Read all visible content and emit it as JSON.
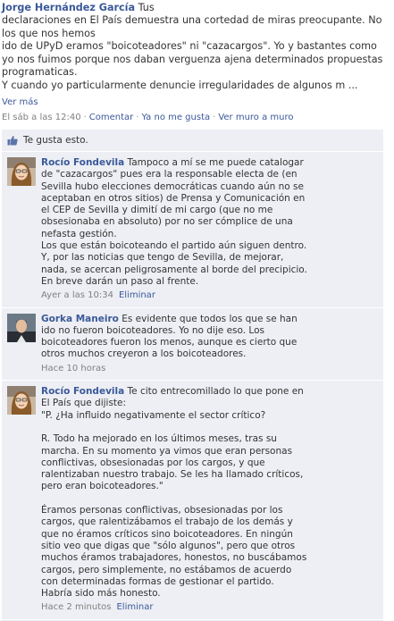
{
  "post": {
    "author": "Jorge Hernández García",
    "first_line": "Tus",
    "text": "declaraciones en El País demuestra una cortedad de miras preocupante. No\nlos que nos hemos\nido de UPyD eramos \"boicoteadores\" ni \"cazacargos\". Yo y bastantes como\nyo nos fuimos porque nos daban verguenza ajena determinados propuestas\nprogramaticas.\nY cuando yo particularmente denuncie irregularidades de algunos m ...",
    "see_more": "Ver más",
    "timestamp": "El sáb a las 12:40",
    "comment_link": "Comentar",
    "unlike_link": "Ya no me gusta",
    "wall_link": "Ver muro a muro"
  },
  "likes": {
    "text": "Te gusta esto."
  },
  "comments": [
    {
      "author": "Rocío Fondevila",
      "text": " Tampoco a mí se me puede catalogar de \"cazacargos\" pues era la responsable electa de (en Sevilla hubo elecciones democráticas cuando aún no se aceptaban en otros sitios) de Prensa y Comunicación en el CEP de Sevilla y dimití de mi cargo (que no me obsesionaba en absoluto) por no ser cómplice de una nefasta gestión.\nLos que están boicoteando el partido aún siguen dentro. Y, por las noticias que tengo de Sevilla, de mejorar, nada, se acercan peligrosamente al borde del precipicio. En breve darán un paso al frente.",
      "time": "Ayer a las 10:34",
      "delete": "Eliminar"
    },
    {
      "author": "Gorka Maneiro",
      "text": " Es evidente que todos los que se han ido no fueron boicoteadores. Yo no dije eso. Los boicoteadores fueron los menos, aunque es cierto que otros muchos creyeron a los boicoteadores.",
      "time": "Hace 10 horas",
      "delete": ""
    },
    {
      "author": "Rocío Fondevila",
      "text": " Te cito entrecomillado lo que pone en El País que dijiste:\n\"P. ¿Ha influido negativamente el sector crítico?\n\nR. Todo ha mejorado en los últimos meses, tras su marcha. En su momento ya vimos que eran personas conflictivas, obsesionadas por los cargos, y que ralentizaban nuestro trabajo. Se les ha llamado críticos, pero eran boicoteadores.\"\n\nÉramos personas conflictivas, obsesionadas por los cargos, que ralentizábamos el trabajo de los demás y que no éramos críticos sino boicoteadores. En ningún sitio veo que digas que \"sólo algunos\", pero que otros muchos éramos trabajadores, honestos, no buscábamos cargos, pero simplemente, no estábamos de acuerdo con determinadas formas de gestionar el partido.\nHabría sido más honesto.",
      "time": "Hace 2 minutos",
      "delete": "Eliminar"
    }
  ],
  "colors": {
    "link": "#3b5998",
    "feedback_bg": "#edeff4",
    "meta": "#808080"
  },
  "icons": {
    "like": "thumbs-up-icon"
  }
}
